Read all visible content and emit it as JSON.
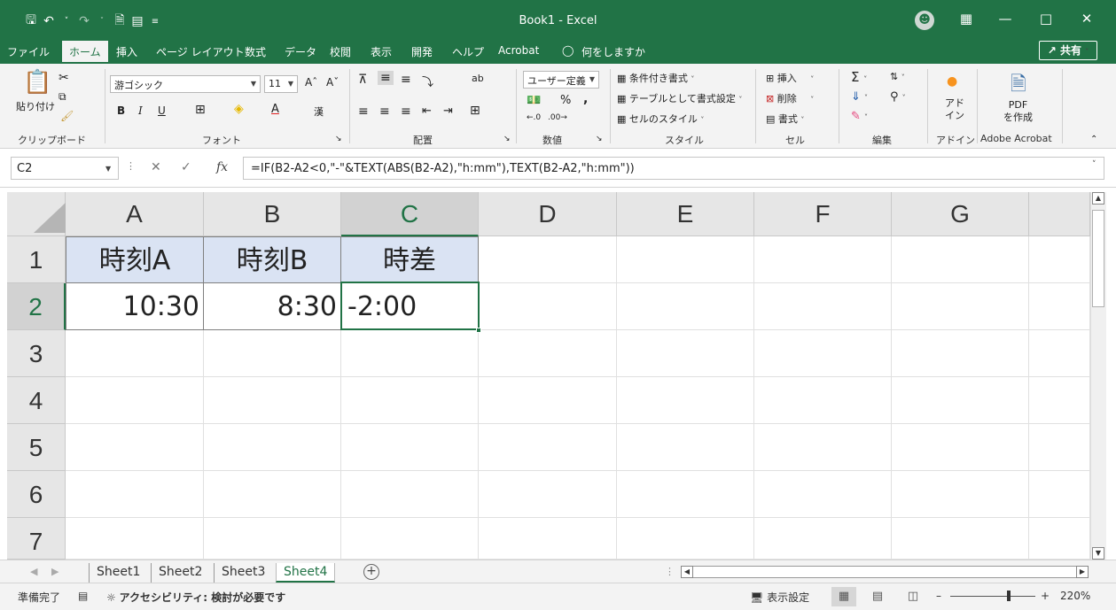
{
  "titlebar": {
    "title": "Book1  -  Excel",
    "qat_icons": [
      "save-icon",
      "undo-icon",
      "redo-icon",
      "print-preview-icon",
      "form-icon",
      "customize-qat-icon"
    ],
    "colors": {
      "accent": "#217346",
      "header_fill": "#dae3f3"
    }
  },
  "tabs": [
    {
      "label": "ファイル",
      "active": false
    },
    {
      "label": "ホーム",
      "active": true
    },
    {
      "label": "挿入",
      "active": false
    },
    {
      "label": "ページ レイアウト",
      "active": false
    },
    {
      "label": "数式",
      "active": false
    },
    {
      "label": "データ",
      "active": false
    },
    {
      "label": "校閲",
      "active": false
    },
    {
      "label": "表示",
      "active": false
    },
    {
      "label": "開発",
      "active": false
    },
    {
      "label": "ヘルプ",
      "active": false
    },
    {
      "label": "Acrobat",
      "active": false
    },
    {
      "label": "何をしますか",
      "active": false
    }
  ],
  "share_label": "共有",
  "ribbon": {
    "paste_label": "貼り付け",
    "font_name": "游ゴシック",
    "font_size": "11",
    "number_format": "ユーザー定義",
    "conditional_format": "条件付き書式",
    "format_as_table": "テーブルとして書式設定",
    "cell_styles": "セルのスタイル",
    "insert": "挿入",
    "delete": "削除",
    "format": "書式",
    "addin": "アド\nイン",
    "pdf": "PDF\nを作成",
    "groups": [
      "クリップボード",
      "フォント",
      "配置",
      "数値",
      "スタイル",
      "セル",
      "編集",
      "アドイン",
      "Adobe Acrobat"
    ]
  },
  "formula_bar": {
    "name_box": "C2",
    "fx": "fx",
    "formula": "=IF(B2-A2<0,\"-\"&TEXT(ABS(B2-A2),\"h:mm\"),TEXT(B2-A2,\"h:mm\"))"
  },
  "grid": {
    "columns": [
      "A",
      "B",
      "C",
      "D",
      "E",
      "F",
      "G"
    ],
    "rows": [
      "1",
      "2",
      "3",
      "4",
      "5",
      "6",
      "7"
    ],
    "cells": {
      "A1": "時刻A",
      "B1": "時刻B",
      "C1": "時差",
      "A2": "10:30",
      "B2": "8:30",
      "C2": "-2:00"
    },
    "selected_cell": "C2"
  },
  "sheets": [
    {
      "name": "Sheet1",
      "active": false
    },
    {
      "name": "Sheet2",
      "active": false
    },
    {
      "name": "Sheet3",
      "active": false
    },
    {
      "name": "Sheet4",
      "active": true
    }
  ],
  "status": {
    "ready": "準備完了",
    "accessibility": "アクセシビリティ: 検討が必要です",
    "display_settings": "表示設定",
    "zoom": "220%"
  }
}
